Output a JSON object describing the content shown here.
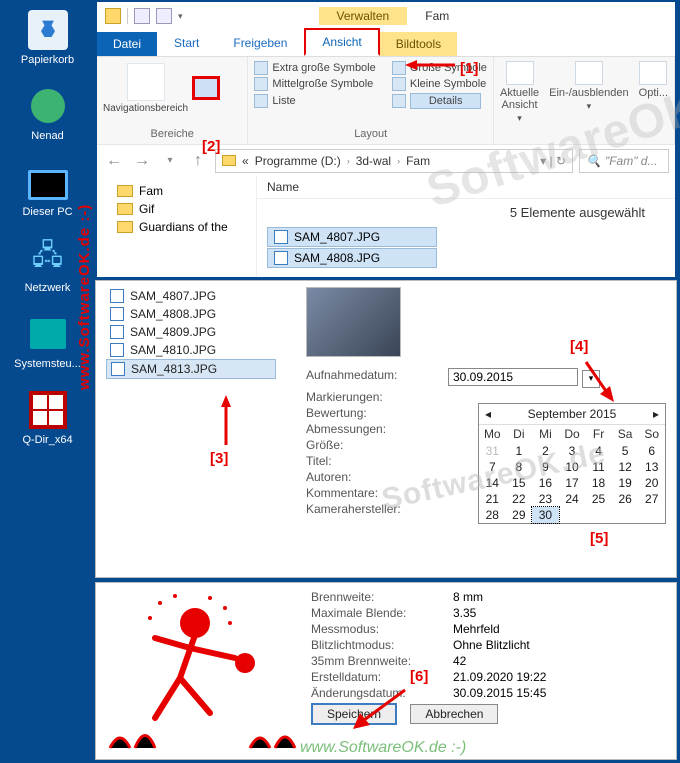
{
  "desktop": {
    "recycle": "Papierkorb",
    "user": "Nenad",
    "pc": "Dieser PC",
    "net": "Netzwerk",
    "sys": "Systemsteu...",
    "qdir": "Q-Dir_x64"
  },
  "explorer": {
    "verwalten": "Verwalten",
    "title": "Fam",
    "tabs": {
      "datei": "Datei",
      "start": "Start",
      "freigeben": "Freigeben",
      "ansicht": "Ansicht",
      "bildtools": "Bildtools"
    },
    "ribbon": {
      "nav_label": "Navigationsbereich",
      "bereiche": "Bereiche",
      "extra": "Extra große Symbole",
      "gross": "Große Symbole",
      "mittel": "Mittelgroße Symbole",
      "kleine": "Kleine Symbole",
      "liste": "Liste",
      "details": "Details",
      "layout": "Layout",
      "aktuelle": "Aktuelle Ansicht",
      "einaus": "Ein-/ausblenden",
      "opti": "Opti..."
    },
    "breadcrumbs": {
      "a": "Programme (D:)",
      "b": "3d-wal",
      "c": "Fam"
    },
    "search_placeholder": "\"Fam\" d...",
    "tree": {
      "fam": "Fam",
      "gif": "Gif",
      "guard": "Guardians of the"
    },
    "col_name": "Name",
    "sel_info": "5 Elemente ausgewählt",
    "sel_files": [
      "SAM_4807.JPG",
      "SAM_4808.JPG"
    ]
  },
  "mid": {
    "files": [
      "SAM_4807.JPG",
      "SAM_4808.JPG",
      "SAM_4809.JPG",
      "SAM_4810.JPG",
      "SAM_4813.JPG"
    ],
    "meta": {
      "aufnahmedatum_k": "Aufnahmedatum:",
      "aufnahmedatum_v": "30.09.2015",
      "markierungen": "Markierungen:",
      "bewertung": "Bewertung:",
      "abmessungen": "Abmessungen:",
      "groesse": "Größe:",
      "titel": "Titel:",
      "autoren": "Autoren:",
      "kommentare": "Kommentare:",
      "kamera": "Kamerahersteller:"
    },
    "calendar": {
      "month": "September 2015",
      "dow": [
        "Mo",
        "Di",
        "Mi",
        "Do",
        "Fr",
        "Sa",
        "So"
      ],
      "lead_out": [
        31
      ],
      "days": [
        1,
        2,
        3,
        4,
        5,
        6,
        7,
        8,
        9,
        10,
        11,
        12,
        13,
        14,
        15,
        16,
        17,
        18,
        19,
        20,
        21,
        22,
        23,
        24,
        25,
        26,
        27,
        28,
        29,
        30
      ],
      "selected": 30
    }
  },
  "bot": {
    "meta": {
      "brennweite_k": "Brennweite:",
      "brennweite_v": "8 mm",
      "blende_k": "Maximale Blende:",
      "blende_v": "3.35",
      "mess_k": "Messmodus:",
      "mess_v": "Mehrfeld",
      "blitz_k": "Blitzlichtmodus:",
      "blitz_v": "Ohne Blitzlicht",
      "bw35_k": "35mm Brennweite:",
      "bw35_v": "42",
      "erstell_k": "Erstelldatum:",
      "erstell_v": "21.09.2020 19:22",
      "aender_k": "Änderungsdatum:",
      "aender_v": "30.09.2015 15:45"
    },
    "buttons": {
      "save": "Speichern",
      "cancel": "Abbrechen"
    }
  },
  "callouts": {
    "c1": "[1]",
    "c2": "[2]",
    "c3": "[3]",
    "c4": "[4]",
    "c5": "[5]",
    "c6": "[6]"
  },
  "branding": {
    "vertical": "www.SoftwareOK.de  :-)",
    "footer": "www.SoftwareOK.de  :-)",
    "wm": "SoftwareOK.de"
  }
}
